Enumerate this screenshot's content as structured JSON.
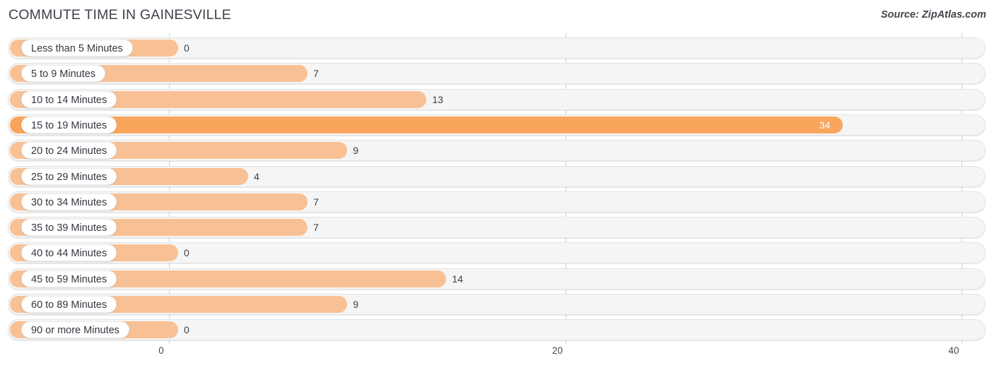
{
  "header": {
    "title": "COMMUTE TIME IN GAINESVILLE",
    "source": "Source: ZipAtlas.com"
  },
  "colors": {
    "bar_light": "#f8c195",
    "bar_highlight": "#f9a55c",
    "track": "#f5f5f5",
    "track_border": "#e4e4e4",
    "gridline": "#d0d0d0",
    "text": "#3c4049",
    "value_in_bar": "#ffffff"
  },
  "chart_data": {
    "type": "bar",
    "orientation": "horizontal",
    "title": "COMMUTE TIME IN GAINESVILLE",
    "xlabel": "",
    "ylabel": "",
    "xlim": [
      0,
      40
    ],
    "xticks": [
      0,
      20,
      40
    ],
    "xtick_labels": [
      "0",
      "20",
      "40"
    ],
    "grid": true,
    "legend": "none",
    "categories": [
      "Less than 5 Minutes",
      "5 to 9 Minutes",
      "10 to 14 Minutes",
      "15 to 19 Minutes",
      "20 to 24 Minutes",
      "25 to 29 Minutes",
      "30 to 34 Minutes",
      "35 to 39 Minutes",
      "40 to 44 Minutes",
      "45 to 59 Minutes",
      "60 to 89 Minutes",
      "90 or more Minutes"
    ],
    "values": [
      0,
      7,
      13,
      34,
      9,
      4,
      7,
      7,
      0,
      14,
      9,
      0
    ],
    "value_labels": [
      "0",
      "7",
      "13",
      "34",
      "9",
      "4",
      "7",
      "7",
      "0",
      "14",
      "9",
      "0"
    ],
    "highlight_index": 3
  },
  "rows": [
    {
      "label": "Less than 5 Minutes",
      "value": 0,
      "value_label": "0"
    },
    {
      "label": "5 to 9 Minutes",
      "value": 7,
      "value_label": "7"
    },
    {
      "label": "10 to 14 Minutes",
      "value": 13,
      "value_label": "13"
    },
    {
      "label": "15 to 19 Minutes",
      "value": 34,
      "value_label": "34"
    },
    {
      "label": "20 to 24 Minutes",
      "value": 9,
      "value_label": "9"
    },
    {
      "label": "25 to 29 Minutes",
      "value": 4,
      "value_label": "4"
    },
    {
      "label": "30 to 34 Minutes",
      "value": 7,
      "value_label": "7"
    },
    {
      "label": "35 to 39 Minutes",
      "value": 7,
      "value_label": "7"
    },
    {
      "label": "40 to 44 Minutes",
      "value": 0,
      "value_label": "0"
    },
    {
      "label": "45 to 59 Minutes",
      "value": 14,
      "value_label": "14"
    },
    {
      "label": "60 to 89 Minutes",
      "value": 9,
      "value_label": "9"
    },
    {
      "label": "90 or more Minutes",
      "value": 0,
      "value_label": "0"
    }
  ]
}
